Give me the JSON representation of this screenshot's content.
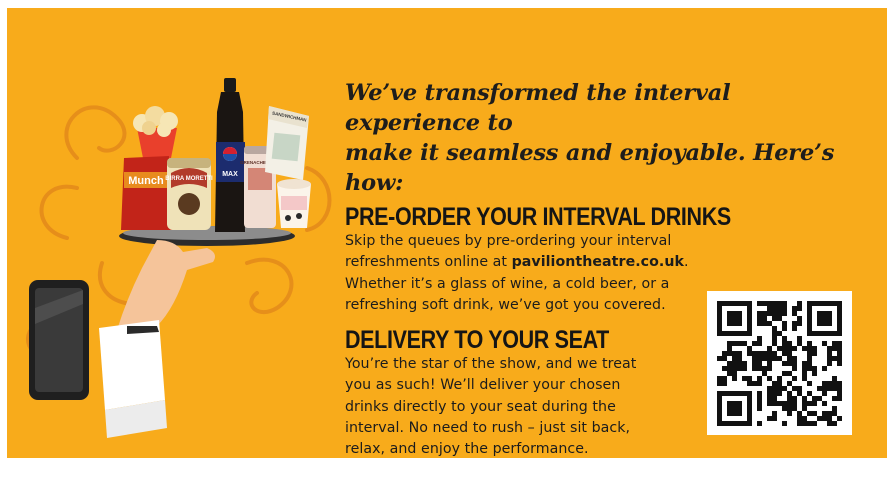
{
  "intro": {
    "line1": "We’ve transformed the interval experience to",
    "line2": "make it seamless and enjoyable. Here’s how:"
  },
  "section1": {
    "heading": "PRE-ORDER YOUR INTERVAL DRINKS",
    "line1": "Skip the queues by pre-ordering your interval",
    "line2_prefix": " refreshments online at ",
    "link": "paviliontheatre.co.uk",
    "line2_suffix": ".",
    "line3": "Whether it’s a glass of wine, a cold beer, or a",
    "line4": "refreshing soft drink, we’ve got you covered."
  },
  "section2": {
    "heading": "DELIVERY TO YOUR SEAT",
    "line1": "You’re the star of the show, and we treat",
    "line2": "you as such! We’ll deliver your chosen",
    "line3": "drinks directly to your seat during the",
    "line4": "interval. No need to rush – just sit back,",
    "line5": "relax, and enjoy the performance."
  },
  "products": {
    "crisps": "Munch",
    "beer": "BIRRA MORETTI",
    "soda": "MAX",
    "drink_can": "GRENACHE ROSE",
    "box": "SANDWICHMAN"
  },
  "colors": {
    "background": "#f8ab1b",
    "text": "#1b1b1b",
    "swirl": "#e3891a"
  }
}
